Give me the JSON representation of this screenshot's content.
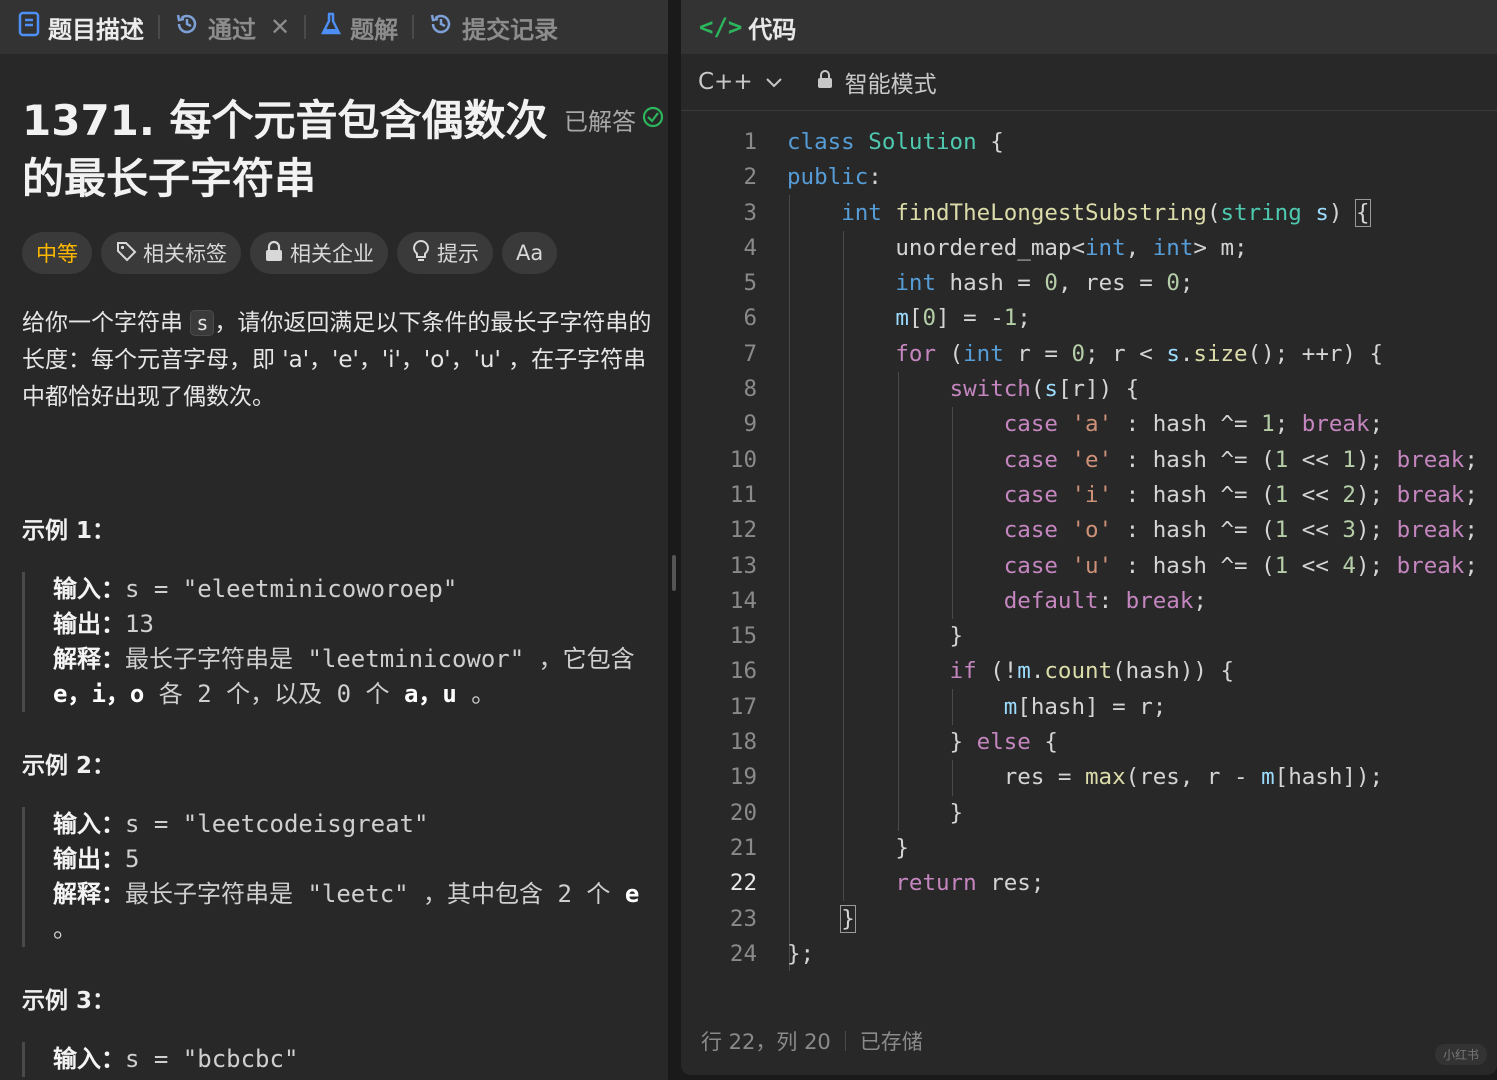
{
  "left": {
    "tabs": [
      {
        "label": "题目描述"
      },
      {
        "label": "通过"
      },
      {
        "label": "题解"
      },
      {
        "label": "提交记录"
      }
    ],
    "title": "1371. 每个元音包含偶数次的最长子字符串",
    "solved_label": "已解答",
    "tags": {
      "difficulty": "中等",
      "related_tags": "相关标签",
      "related_companies": "相关企业",
      "hint": "提示",
      "font": "Aa"
    },
    "description": {
      "part1": "给你一个字符串 ",
      "code": "s",
      "part2": "，请你返回满足以下条件的最长子字符串的长度：每个元音字母，即 'a'，'e'，'i'，'o'，'u' ，在子字符串中都恰好出现了偶数次。"
    },
    "examples": [
      {
        "title": "示例 1：",
        "input_label": "输入：",
        "input": "s = \"eleetminicoworoep\"",
        "output_label": "输出：",
        "output": "13",
        "explain_label": "解释：",
        "explain_a": "最长子字符串是 \"leetminicowor\" ，它包含 ",
        "explain_b": "e，i，o",
        "explain_c": " 各 2 个，以及 0 个 ",
        "explain_d": "a，u",
        "explain_e": " 。"
      },
      {
        "title": "示例 2：",
        "input_label": "输入：",
        "input": "s = \"leetcodeisgreat\"",
        "output_label": "输出：",
        "output": "5",
        "explain_label": "解释：",
        "explain_a": "最长子字符串是 \"leetc\" ，其中包含 2 个 ",
        "explain_b": "e",
        "explain_c": " 。"
      },
      {
        "title": "示例 3：",
        "input_label": "输入：",
        "input": "s = \"bcbcbc\""
      }
    ]
  },
  "right": {
    "header_title": "代码",
    "language": "C++",
    "mode": "智能模式",
    "line_numbers": [
      "1",
      "2",
      "3",
      "4",
      "5",
      "6",
      "7",
      "8",
      "9",
      "10",
      "11",
      "12",
      "13",
      "14",
      "15",
      "16",
      "17",
      "18",
      "19",
      "20",
      "21",
      "22",
      "23",
      "24"
    ],
    "current_line": "22",
    "status": {
      "cursor": "行 22，列 20",
      "saved": "已存储"
    },
    "watermark": "小红书"
  }
}
